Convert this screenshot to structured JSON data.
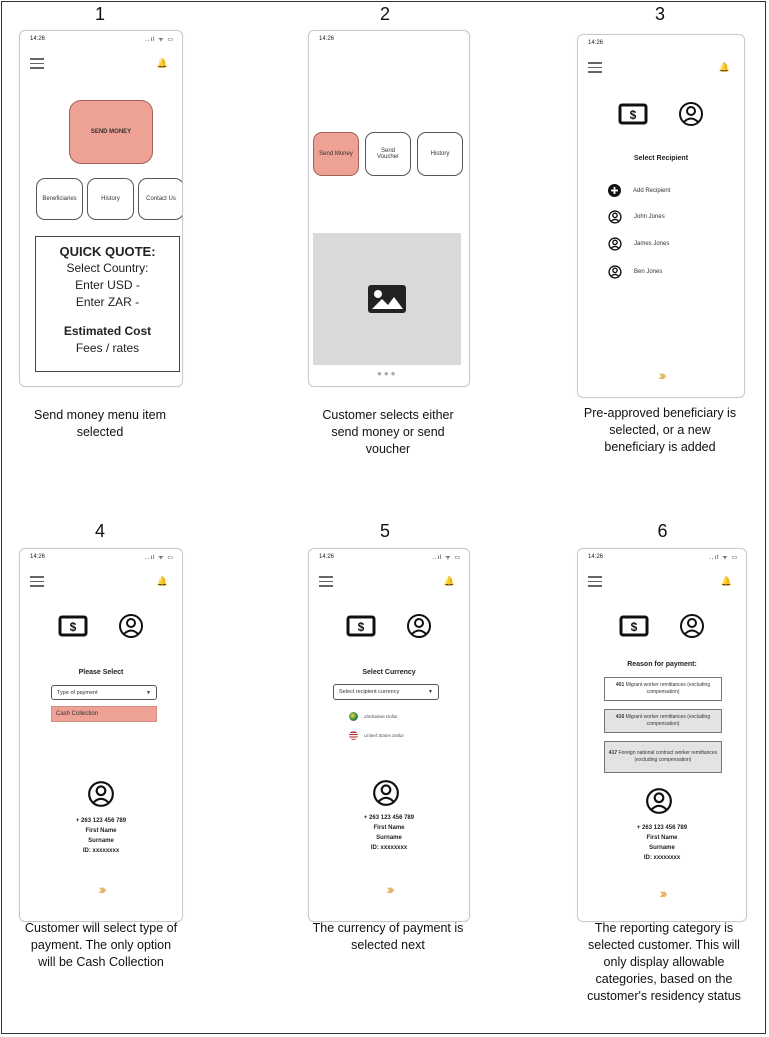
{
  "status": {
    "time": "14:26",
    "icons": "..ıl ᯤ ▭"
  },
  "steps": [
    {
      "num": "1",
      "caption": "Send money menu item selected"
    },
    {
      "num": "2",
      "caption": "Customer selects either send money or send voucher"
    },
    {
      "num": "3",
      "caption": "Pre-approved beneficiary is selected, or a new beneficiary is added"
    },
    {
      "num": "4",
      "caption": "Customer will select type of payment. The only option will be Cash Collection"
    },
    {
      "num": "5",
      "caption": "The currency of payment is selected next"
    },
    {
      "num": "6",
      "caption": "The reporting category is selected customer. This will only display allowable categories, based on the customer's residency status"
    }
  ],
  "screen1": {
    "send_money": "SEND MONEY",
    "buttons": [
      "Beneficiaries",
      "History",
      "Contact Us"
    ],
    "quick_quote": {
      "title": "QUICK QUOTE:",
      "select_country": "Select Country:",
      "enter_usd": "Enter USD -",
      "enter_zar": "Enter ZAR -",
      "estimated_cost": "Estimated Cost",
      "fees": "Fees / rates"
    }
  },
  "screen2": {
    "buttons": [
      "Send Money",
      "Send Voucher",
      "History"
    ],
    "dots": "●●●"
  },
  "screen3": {
    "title": "Select Recipient",
    "add_recipient": "Add Recipient",
    "recipients": [
      "John Jones",
      "James Jones",
      "Ben Jones"
    ]
  },
  "screen4": {
    "title": "Please Select",
    "select_placeholder": "Type of payment",
    "option": "Cash Collection"
  },
  "screen5": {
    "title": "Select Currency",
    "select_placeholder": "Select recipient currency",
    "currencies": [
      "Zimbabwe Dollar",
      "United States Dollar"
    ]
  },
  "screen6": {
    "title": "Reason for payment:",
    "reasons": [
      {
        "code": "401",
        "text": "Migrant worker remittances (excluding compensation)"
      },
      {
        "code": "416",
        "text": "Migrant worker remittances (excluding compensation)"
      },
      {
        "code": "417",
        "text": "Foreign national contract worker remittances (excluding compensation)"
      }
    ]
  },
  "profile": {
    "phone": "+ 263 123 456 789",
    "first_name": "First Name",
    "surname": "Surname",
    "id": "ID: xxxxxxxx"
  },
  "colors": {
    "accent": "#eea195",
    "chevron": "#e0a43b",
    "image_placeholder": "#d9d9d9"
  }
}
